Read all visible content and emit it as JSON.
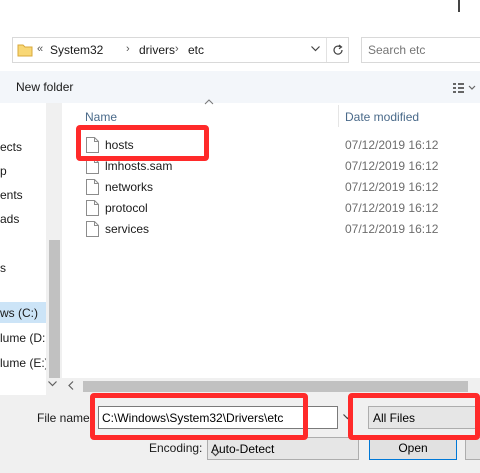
{
  "address_bar": {
    "overflow": "«",
    "crumbs": [
      "System32",
      "drivers",
      "etc"
    ],
    "separator": "›",
    "dropdown_icon": "chevron-down-icon",
    "refresh_icon": "refresh-icon"
  },
  "search": {
    "placeholder": "Search etc"
  },
  "toolbar": {
    "new_folder_label": "New folder",
    "view_icon": "view-options-icon"
  },
  "nav_pane": {
    "items": [
      "ects",
      "p",
      "ents",
      "ads",
      "s",
      "ws (C:)",
      "lume (D:",
      "lume (E:)"
    ],
    "selected": "ws (C:)"
  },
  "file_list": {
    "columns": {
      "name": "Name",
      "date_modified": "Date modified"
    },
    "files": [
      {
        "name": "hosts",
        "date": "07/12/2019 16:12"
      },
      {
        "name": "lmhosts.sam",
        "date": "07/12/2019 16:12"
      },
      {
        "name": "networks",
        "date": "07/12/2019 16:12"
      },
      {
        "name": "protocol",
        "date": "07/12/2019 16:12"
      },
      {
        "name": "services",
        "date": "07/12/2019 16:12"
      }
    ]
  },
  "footer": {
    "filename_label": "File name:",
    "filename_value": "C:\\Windows\\System32\\Drivers\\etc",
    "filetype_value": "All Files",
    "encoding_label": "Encoding:",
    "encoding_value": "Auto-Detect",
    "open_label": "Open"
  },
  "colors": {
    "highlight": "#ff2a2a",
    "selection": "#cce4f7",
    "footer_bg": "#f0f0f0",
    "accent_border": "#0078d7"
  }
}
